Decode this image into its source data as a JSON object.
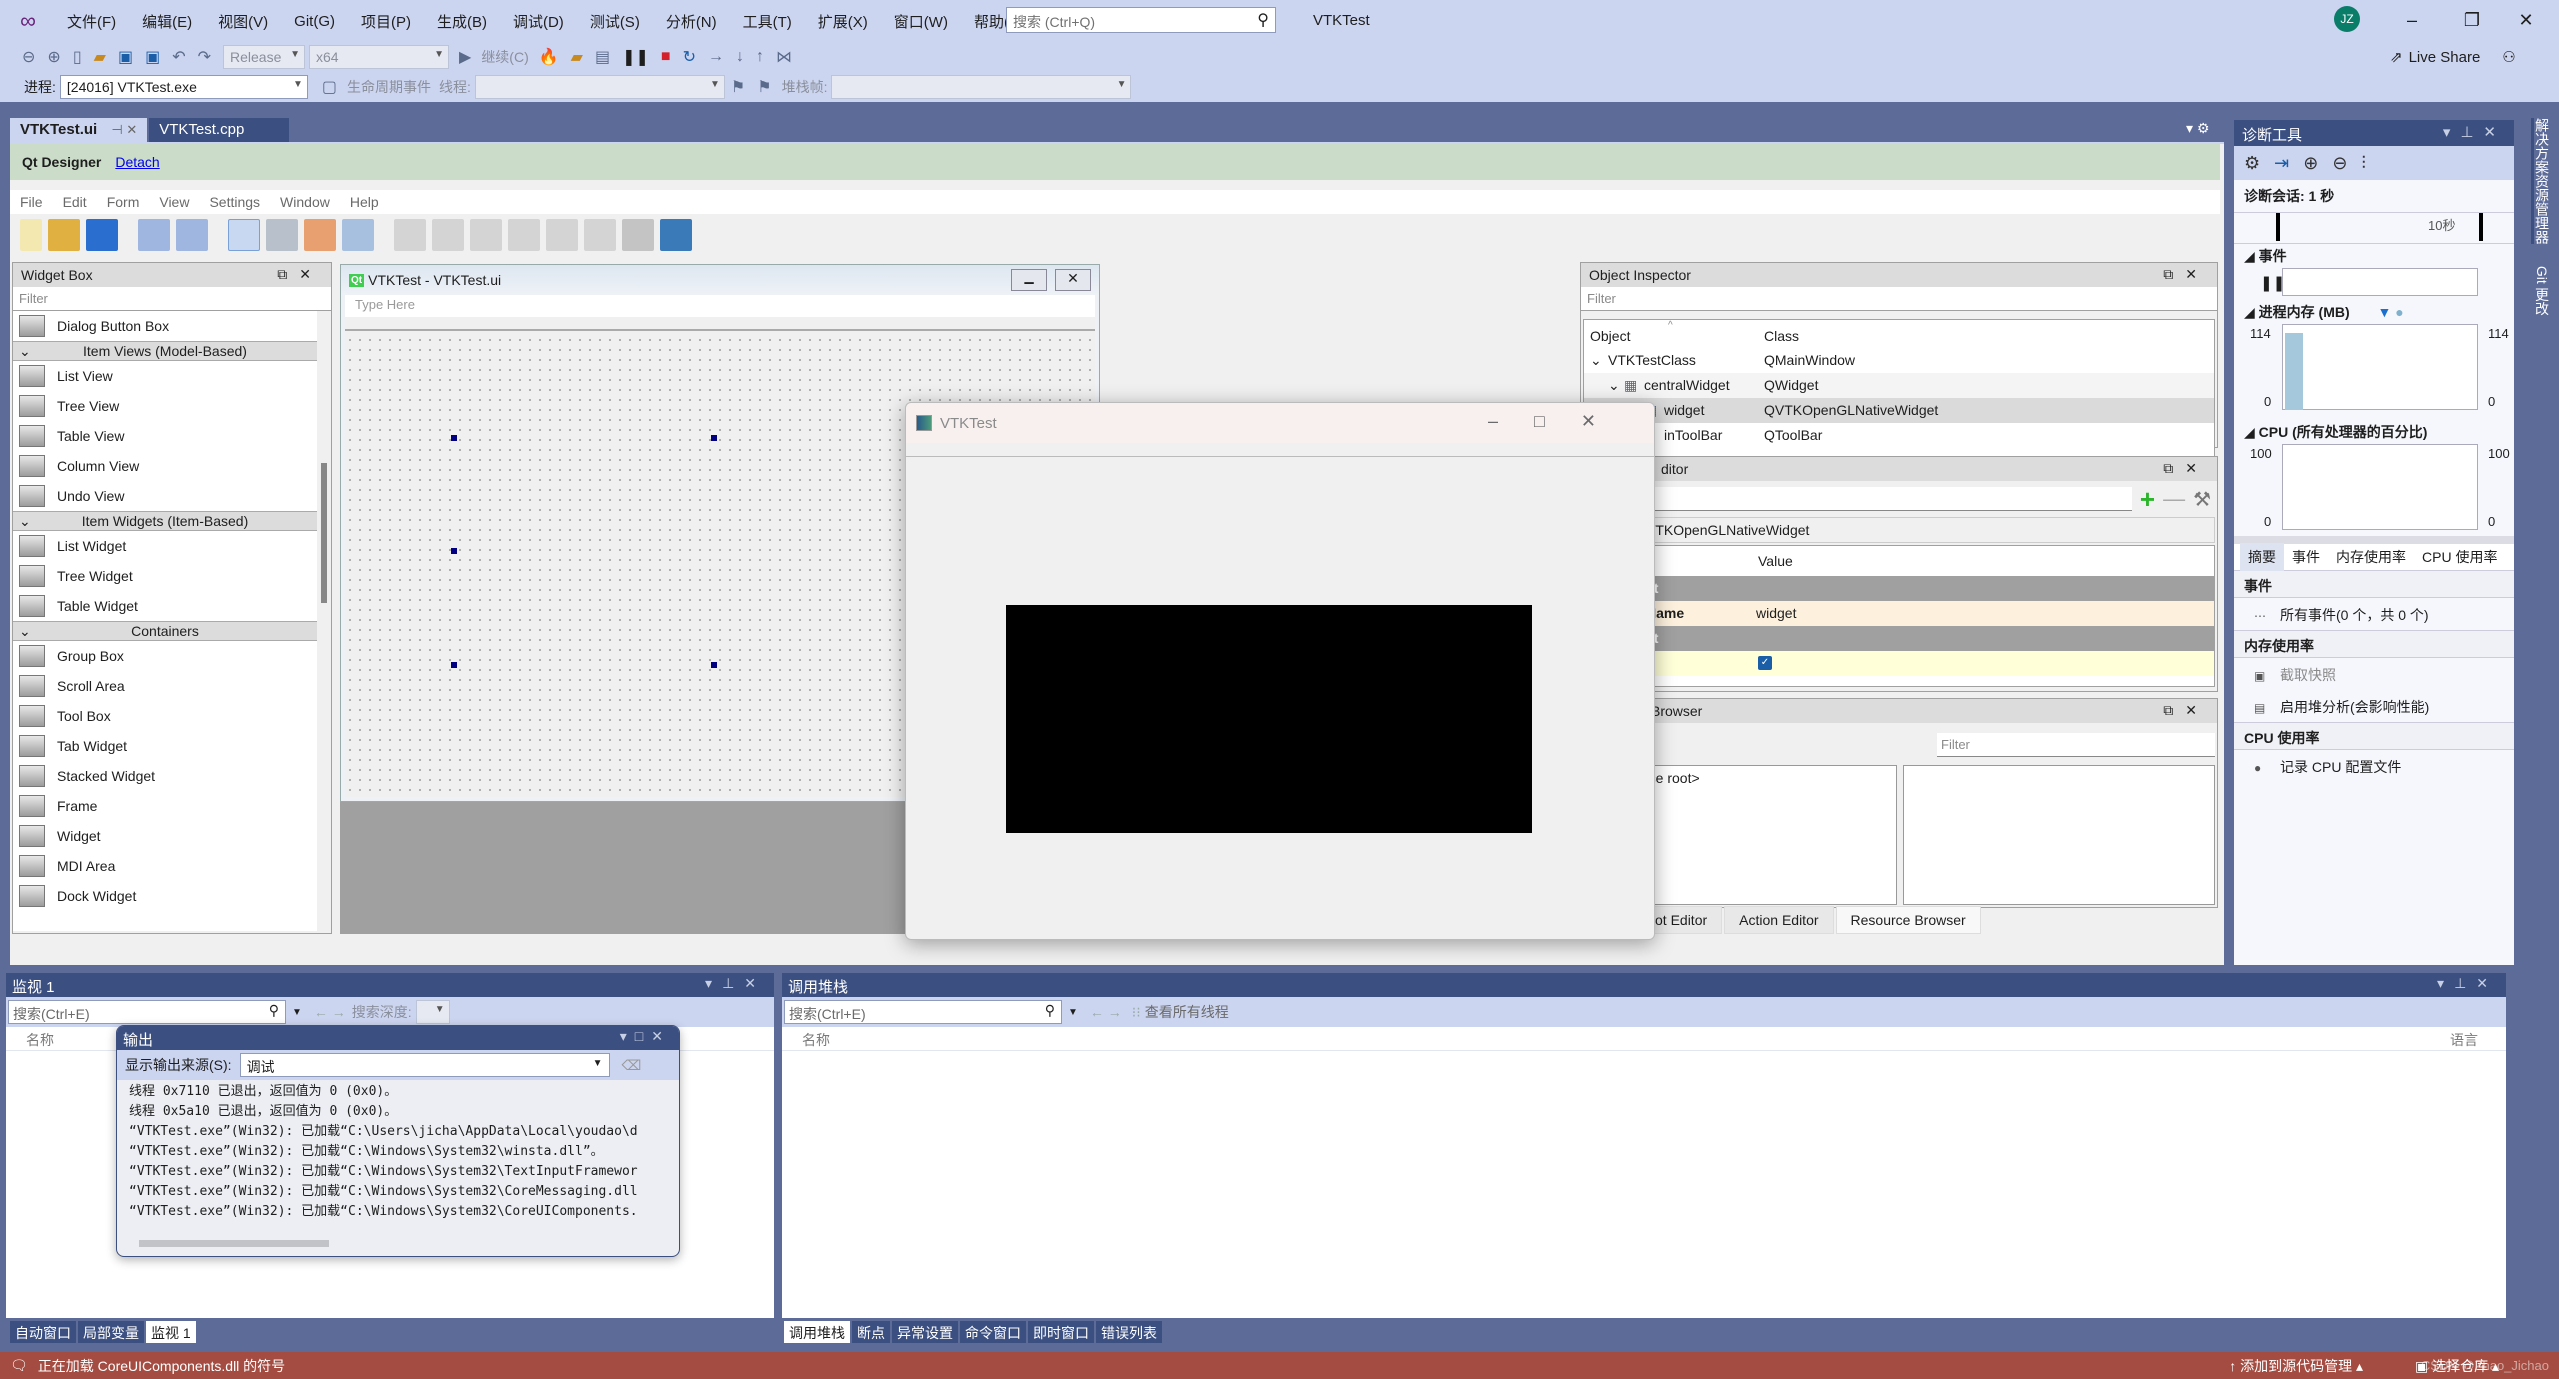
{
  "title_bar": {
    "menu": [
      "文件(F)",
      "编辑(E)",
      "视图(V)",
      "Git(G)",
      "项目(P)",
      "生成(B)",
      "调试(D)",
      "测试(S)",
      "分析(N)",
      "工具(T)",
      "扩展(X)",
      "窗口(W)",
      "帮助(H)"
    ],
    "search_placeholder": "搜索 (Ctrl+Q)",
    "app_title": "VTKTest",
    "avatar_initials": "JZ",
    "live_share": "Live Share"
  },
  "toolbar": {
    "config": "Release",
    "platform": "x64",
    "continue": "继续(C)",
    "process_label": "进程:",
    "process_value": "[24016] VTKTest.exe",
    "lifecycle": "生命周期事件",
    "thread_label": "线程:",
    "stackframe_label": "堆栈帧:"
  },
  "doc_tabs": [
    {
      "label": "VTKTest.ui",
      "active": true
    },
    {
      "label": "VTKTest.cpp",
      "active": false
    }
  ],
  "qt_designer": {
    "title": "Qt Designer",
    "detach": "Detach",
    "menu": [
      "File",
      "Edit",
      "Form",
      "View",
      "Settings",
      "Window",
      "Help"
    ]
  },
  "widget_box": {
    "title": "Widget Box",
    "filter_placeholder": "Filter",
    "items": [
      {
        "type": "item",
        "label": "Dialog Button Box"
      },
      {
        "type": "cat",
        "label": "Item Views (Model-Based)"
      },
      {
        "type": "item",
        "label": "List View"
      },
      {
        "type": "item",
        "label": "Tree View"
      },
      {
        "type": "item",
        "label": "Table View"
      },
      {
        "type": "item",
        "label": "Column View"
      },
      {
        "type": "item",
        "label": "Undo View"
      },
      {
        "type": "cat",
        "label": "Item Widgets (Item-Based)"
      },
      {
        "type": "item",
        "label": "List Widget"
      },
      {
        "type": "item",
        "label": "Tree Widget"
      },
      {
        "type": "item",
        "label": "Table Widget"
      },
      {
        "type": "cat",
        "label": "Containers"
      },
      {
        "type": "item",
        "label": "Group Box"
      },
      {
        "type": "item",
        "label": "Scroll Area"
      },
      {
        "type": "item",
        "label": "Tool Box"
      },
      {
        "type": "item",
        "label": "Tab Widget"
      },
      {
        "type": "item",
        "label": "Stacked Widget"
      },
      {
        "type": "item",
        "label": "Frame"
      },
      {
        "type": "item",
        "label": "Widget"
      },
      {
        "type": "item",
        "label": "MDI Area"
      },
      {
        "type": "item",
        "label": "Dock Widget"
      }
    ]
  },
  "form_window": {
    "title": "VTKTest - VTKTest.ui",
    "menu_placeholder": "Type Here"
  },
  "vtk_window": {
    "title": "VTKTest"
  },
  "object_inspector": {
    "title": "Object Inspector",
    "filter_placeholder": "Filter",
    "col_object": "Object",
    "col_class": "Class",
    "rows": [
      {
        "object": "VTKTestClass",
        "class": "QMainWindow"
      },
      {
        "object": "centralWidget",
        "class": "QWidget"
      },
      {
        "object": "widget",
        "class": "QVTKOpenGLNativeWidget"
      },
      {
        "object": "inToolBar",
        "class": "QToolBar"
      }
    ]
  },
  "property_editor": {
    "title_partial": "ditor",
    "class_partial": "VTKOpenGLNativeWidget",
    "col_value": "Value",
    "rows": [
      {
        "kind": "group",
        "prop": "ct",
        "value": ""
      },
      {
        "kind": "prop",
        "prop": "Name",
        "value": "widget"
      },
      {
        "kind": "group",
        "prop": "et",
        "value": ""
      },
      {
        "kind": "prop2",
        "prop": "d",
        "value": "checked"
      }
    ]
  },
  "resource_browser": {
    "title_partial": "Browser",
    "filter_placeholder": "Filter",
    "root_partial": "rce root>",
    "tabs": [
      "ot Editor",
      "Action Editor",
      "Resource Browser"
    ]
  },
  "diagnostics": {
    "title": "诊断工具",
    "session": "诊断会话: 1 秒",
    "timeline_label": "10秒",
    "events_label": "事件",
    "memory_label": "进程内存 (MB)",
    "memory_max": "114",
    "memory_min": "0",
    "cpu_label": "CPU (所有处理器的百分比)",
    "cpu_max": "100",
    "cpu_min": "0",
    "tabs": [
      "摘要",
      "事件",
      "内存使用率",
      "CPU 使用率"
    ],
    "sections": [
      {
        "header": "事件",
        "items": [
          {
            "icon": "events-icon",
            "label": "所有事件(0 个，共 0 个)"
          }
        ]
      },
      {
        "header": "内存使用率",
        "items": [
          {
            "icon": "camera-icon",
            "label": "截取快照"
          },
          {
            "icon": "heap-icon",
            "label": "启用堆分析(会影响性能)"
          }
        ]
      },
      {
        "header": "CPU 使用率",
        "items": [
          {
            "icon": "record-icon",
            "label": "记录 CPU 配置文件"
          }
        ]
      }
    ]
  },
  "side_strip": [
    "解决方案资源管理器",
    "Git 更改"
  ],
  "watch": {
    "title": "监视 1",
    "search_placeholder": "搜索(Ctrl+E)",
    "depth_label": "搜索深度:",
    "col_name": "名称",
    "tabs": [
      "自动窗口",
      "局部变量",
      "监视 1"
    ]
  },
  "output": {
    "title": "输出",
    "source_label": "显示输出来源(S):",
    "source_value": "调试",
    "lines": [
      "线程 0x7110 已退出，返回值为 0 (0x0)。",
      "线程 0x5a10 已退出，返回值为 0 (0x0)。",
      "“VTKTest.exe”(Win32): 已加载“C:\\Users\\jicha\\AppData\\Local\\youdao\\d",
      "“VTKTest.exe”(Win32): 已加载“C:\\Windows\\System32\\winsta.dll”。",
      "“VTKTest.exe”(Win32): 已加载“C:\\Windows\\System32\\TextInputFramewor",
      "“VTKTest.exe”(Win32): 已加载“C:\\Windows\\System32\\CoreMessaging.dll",
      "“VTKTest.exe”(Win32): 已加载“C:\\Windows\\System32\\CoreUIComponents."
    ]
  },
  "callstack": {
    "title": "调用堆栈",
    "search_placeholder": "搜索(Ctrl+E)",
    "all_threads": "查看所有线程",
    "col_name": "名称",
    "col_lang": "语言",
    "tabs": [
      "调用堆栈",
      "断点",
      "异常设置",
      "命令窗口",
      "即时窗口",
      "错误列表"
    ]
  },
  "status_bar": {
    "message": "正在加载 CoreUIComponents.dll 的符号",
    "source_control": "添加到源代码管理",
    "repo": "选择仓库",
    "watermark": "CSDN @Zhao_Jichao"
  },
  "colors": {
    "accent": "#3b4f81",
    "chrome": "#ccd5f0",
    "status": "#a44c41",
    "qt_bar": "#cbddc9"
  }
}
